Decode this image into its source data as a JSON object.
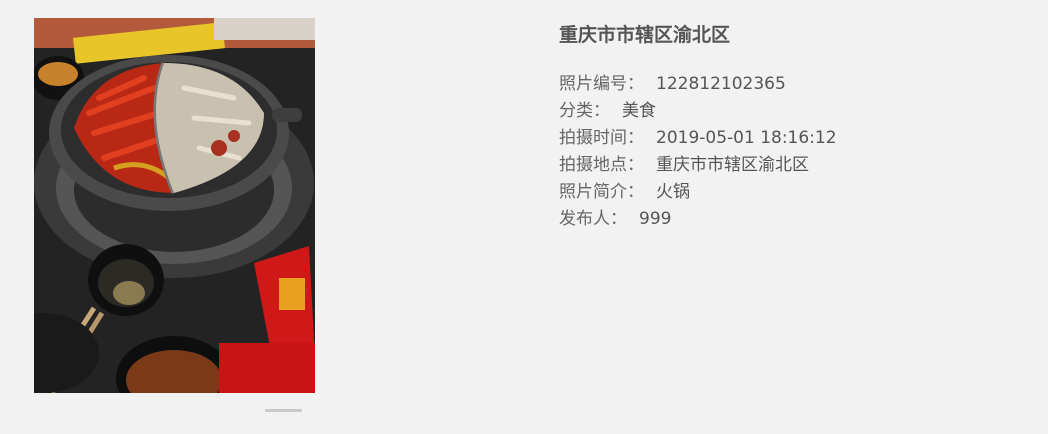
{
  "photo": {
    "icon": "hotpot-photo"
  },
  "detail": {
    "title": "重庆市市辖区渝北区",
    "rows": [
      {
        "label": "照片编号",
        "value": "122812102365"
      },
      {
        "label": "分类",
        "value": "美食"
      },
      {
        "label": "拍摄时间",
        "value": "2019-05-01 18:16:12"
      },
      {
        "label": "拍摄地点",
        "value": "重庆市市辖区渝北区"
      },
      {
        "label": "照片简介",
        "value": "火锅"
      },
      {
        "label": "发布人",
        "value": "999"
      }
    ],
    "separator": "："
  },
  "colors": {
    "background": "#f2f2f2",
    "text": "#555555",
    "pager": "#c9c9c9"
  }
}
